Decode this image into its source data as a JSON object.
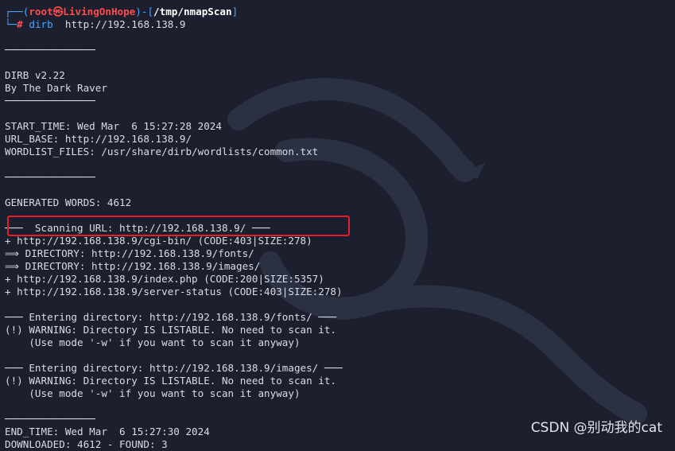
{
  "prompt": {
    "corner_top": "┌──(",
    "user": "root",
    "at_symbol": "㉿",
    "host": "LivingOnHope",
    "path_open": ")-[",
    "path": "/tmp/nmapScan",
    "path_close": "]",
    "corner_bottom": "└─",
    "hash": "#",
    "command": "dirb",
    "argument": "http://192.168.138.9"
  },
  "output": [
    "",
    "───────────────",
    "",
    "DIRB v2.22",
    "By The Dark Raver",
    "───────────────",
    "",
    "START_TIME: Wed Mar  6 15:27:28 2024",
    "URL_BASE: http://192.168.138.9/",
    "WORDLIST_FILES: /usr/share/dirb/wordlists/common.txt",
    "",
    "───────────────",
    "",
    "GENERATED WORDS: 4612",
    "",
    "───  Scanning URL: http://192.168.138.9/ ───",
    "+ http://192.168.138.9/cgi-bin/ (CODE:403|SIZE:278)",
    "⟹ DIRECTORY: http://192.168.138.9/fonts/",
    "⟹ DIRECTORY: http://192.168.138.9/images/",
    "+ http://192.168.138.9/index.php (CODE:200|SIZE:5357)",
    "+ http://192.168.138.9/server-status (CODE:403|SIZE:278)",
    "",
    "─── Entering directory: http://192.168.138.9/fonts/ ───",
    "(!) WARNING: Directory IS LISTABLE. No need to scan it.",
    "    (Use mode '-w' if you want to scan it anyway)",
    "",
    "─── Entering directory: http://192.168.138.9/images/ ───",
    "(!) WARNING: Directory IS LISTABLE. No need to scan it.",
    "    (Use mode '-w' if you want to scan it anyway)",
    "",
    "───────────────",
    "END_TIME: Wed Mar  6 15:27:30 2024",
    "DOWNLOADED: 4612 - FOUND: 3"
  ],
  "watermark": "CSDN @别动我的cat",
  "colors": {
    "background": "#1b1f2e",
    "prompt_blue": "#4aa3ff",
    "prompt_red": "#ff4b4b",
    "highlight_box": "#e0202a",
    "text": "#d9dde6"
  }
}
